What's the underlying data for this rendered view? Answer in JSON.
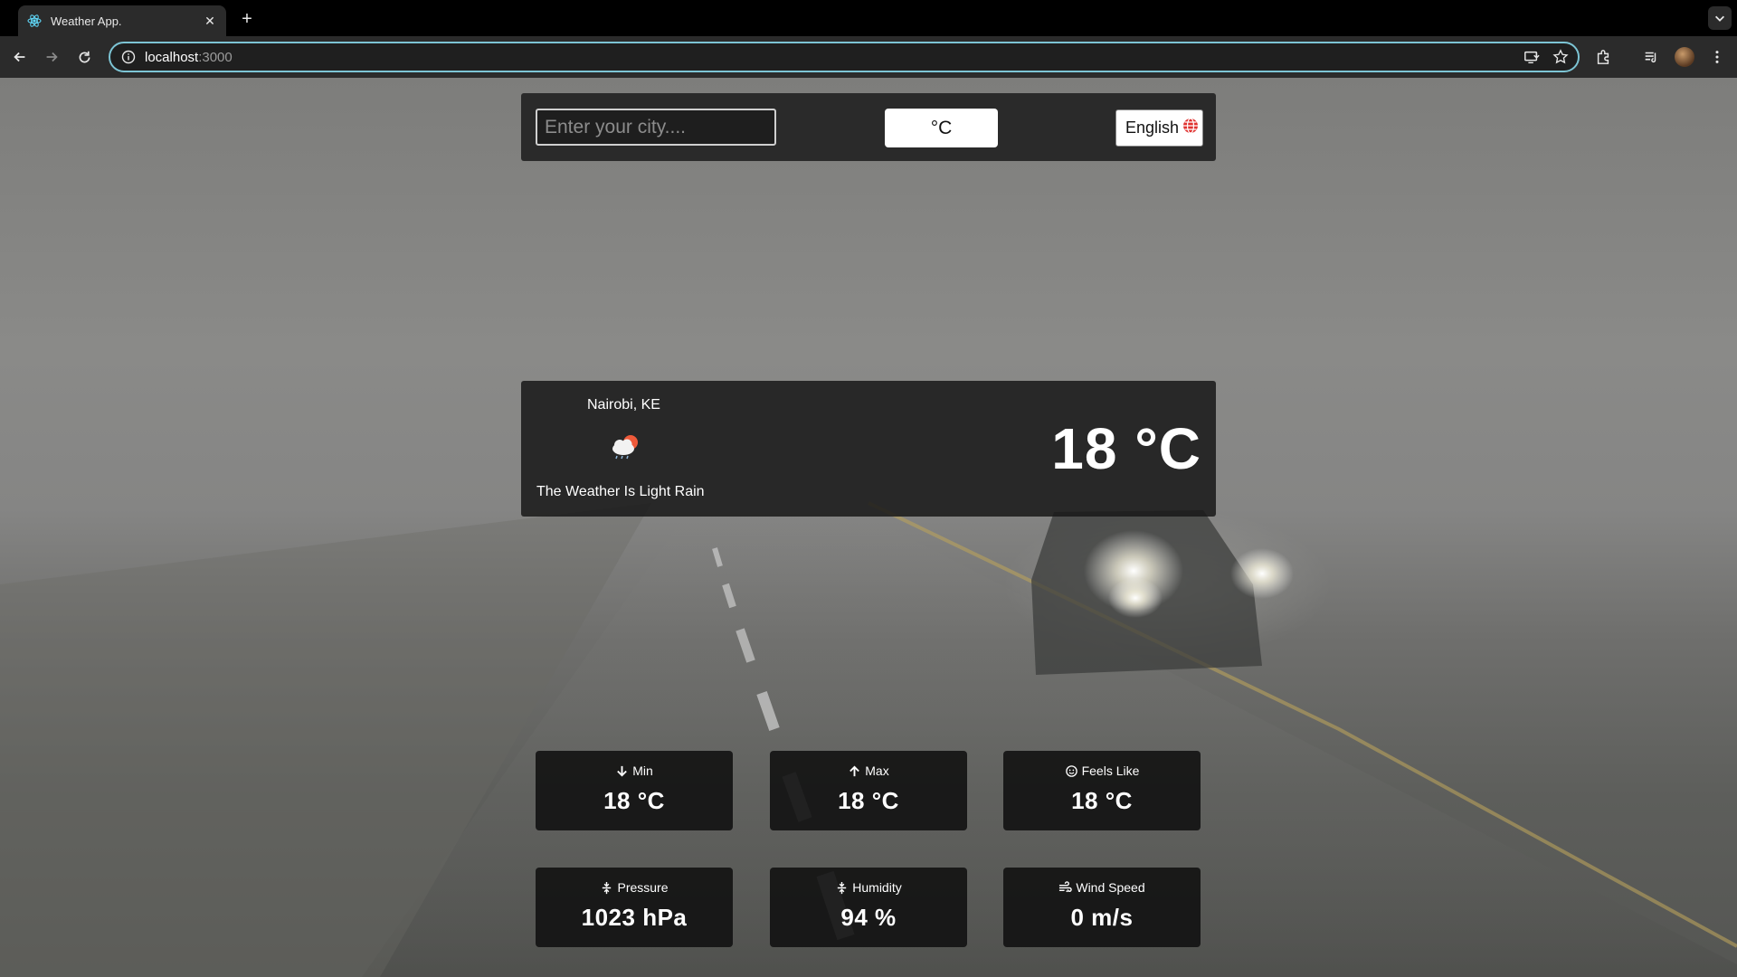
{
  "browser": {
    "tab_title": "Weather App.",
    "url_host": "localhost",
    "url_port": ":3000"
  },
  "search": {
    "placeholder": "Enter your city....",
    "value": ""
  },
  "unit_toggle": {
    "label": "°C"
  },
  "language": {
    "label": "English"
  },
  "current": {
    "city": "Nairobi, KE",
    "icon": "cloud-sun-rain-icon",
    "description": "The Weather Is Light Rain",
    "temperature": "18 °C"
  },
  "stats": [
    {
      "label": "Min",
      "value": "18 °C",
      "icon": "arrow-down-icon"
    },
    {
      "label": "Max",
      "value": "18 °C",
      "icon": "arrow-up-icon"
    },
    {
      "label": "Feels Like",
      "value": "18 °C",
      "icon": "smile-icon"
    },
    {
      "label": "Pressure",
      "value": "1023 hPa",
      "icon": "compress-icon"
    },
    {
      "label": "Humidity",
      "value": "94 %",
      "icon": "compress-icon"
    },
    {
      "label": "Wind Speed",
      "value": "0 m/s",
      "icon": "wind-icon"
    }
  ],
  "colors": {
    "omnibox_focus": "#7cc4d4",
    "card_bg": "#191919",
    "flag_red": "#e0312f"
  }
}
